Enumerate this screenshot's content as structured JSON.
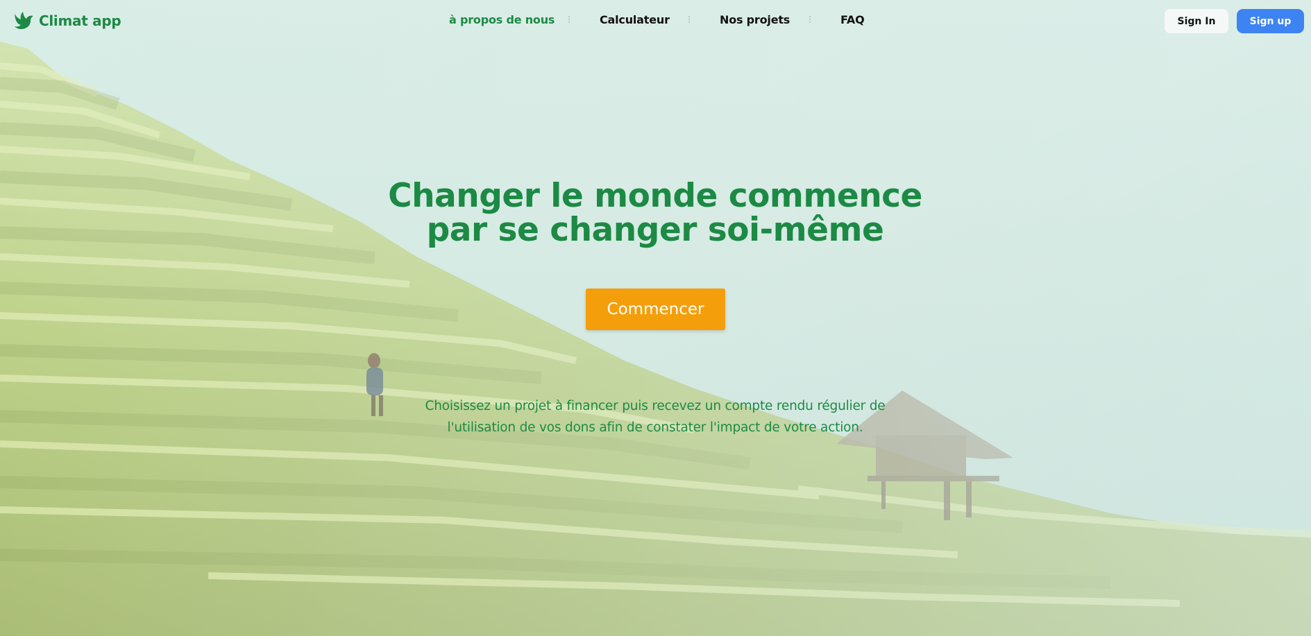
{
  "brand": {
    "name": "Climat app",
    "icon": "dove-icon",
    "color": "#1c8a44"
  },
  "nav": {
    "items": [
      {
        "label": "à propos de nous",
        "active": true
      },
      {
        "label": "Calculateur",
        "active": false
      },
      {
        "label": "Nos projets",
        "active": false
      },
      {
        "label": "FAQ",
        "active": false
      }
    ]
  },
  "auth": {
    "signin_label": "Sign In",
    "signup_label": "Sign up",
    "signup_color": "#3d83f2"
  },
  "hero": {
    "title_line1": "Changer le monde commence",
    "title_line2": "par se changer soi-même",
    "cta_label": "Commencer",
    "cta_color": "#f59e0b",
    "text_line1": "Choisissez un projet à financer puis recevez un compte rendu régulier de",
    "text_line2": "l'utilisation de vos dons afin de constater l'impact de votre action."
  },
  "background": {
    "subject": "rice terraces with a hut and a person",
    "accent_color": "#b9cf6a"
  }
}
